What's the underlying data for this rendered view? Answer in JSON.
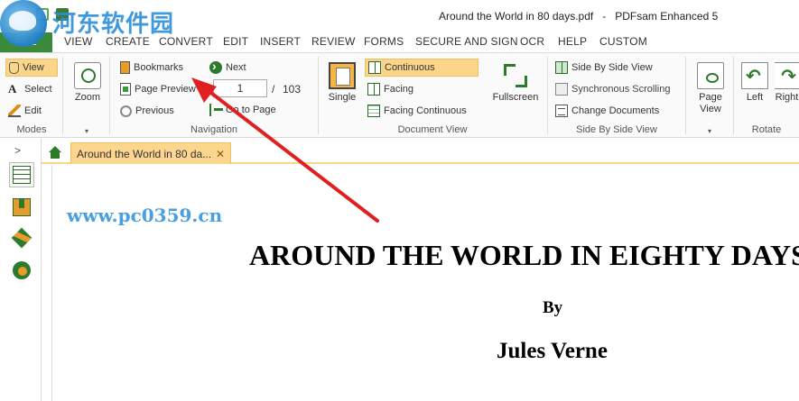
{
  "window": {
    "title": "Around the World in 80 days.pdf   -   PDFsam Enhanced 5"
  },
  "watermark": {
    "brand_text": "河东软件园",
    "url_text": "www.pc0359.cn"
  },
  "menu": {
    "file": "FILE",
    "items": [
      "VIEW",
      "CREATE",
      "CONVERT",
      "EDIT",
      "INSERT",
      "REVIEW",
      "FORMS",
      "SECURE AND SIGN",
      "OCR",
      "HELP",
      "CUSTOM"
    ]
  },
  "ribbon": {
    "modes": {
      "label": "Modes",
      "view": "View",
      "select": "Select",
      "edit": "Edit"
    },
    "zoom": {
      "label": "Zoom"
    },
    "navigation": {
      "label": "Navigation",
      "bookmarks": "Bookmarks",
      "page_preview": "Page Preview",
      "previous": "Previous",
      "next": "Next",
      "go_to_page": "Go to Page",
      "current_page": "1",
      "separator": "/",
      "total_pages": "103"
    },
    "document_view": {
      "label": "Document View",
      "single": "Single",
      "continuous": "Continuous",
      "facing": "Facing",
      "facing_continuous": "Facing Continuous",
      "fullscreen": "Fullscreen"
    },
    "side_by_side": {
      "label": "Side By Side View",
      "side_by_side_view": "Side By Side View",
      "sync_scrolling": "Synchronous Scrolling",
      "change_documents": "Change Documents"
    },
    "page_view": {
      "label": "Page View"
    },
    "rotate": {
      "label": "Rotate",
      "left": "Left",
      "right": "Right"
    }
  },
  "tabs": {
    "document_tab": "Around the World in 80 da...",
    "close": "✕"
  },
  "sidepanel": {
    "expand": ">"
  },
  "document": {
    "title": "AROUND THE WORLD IN EIGHTY DAYS",
    "by": "By",
    "author": "Jules Verne"
  },
  "colors": {
    "accent_green": "#3b8a3b",
    "highlight": "#fbd58a",
    "arrow": "#e02020"
  }
}
